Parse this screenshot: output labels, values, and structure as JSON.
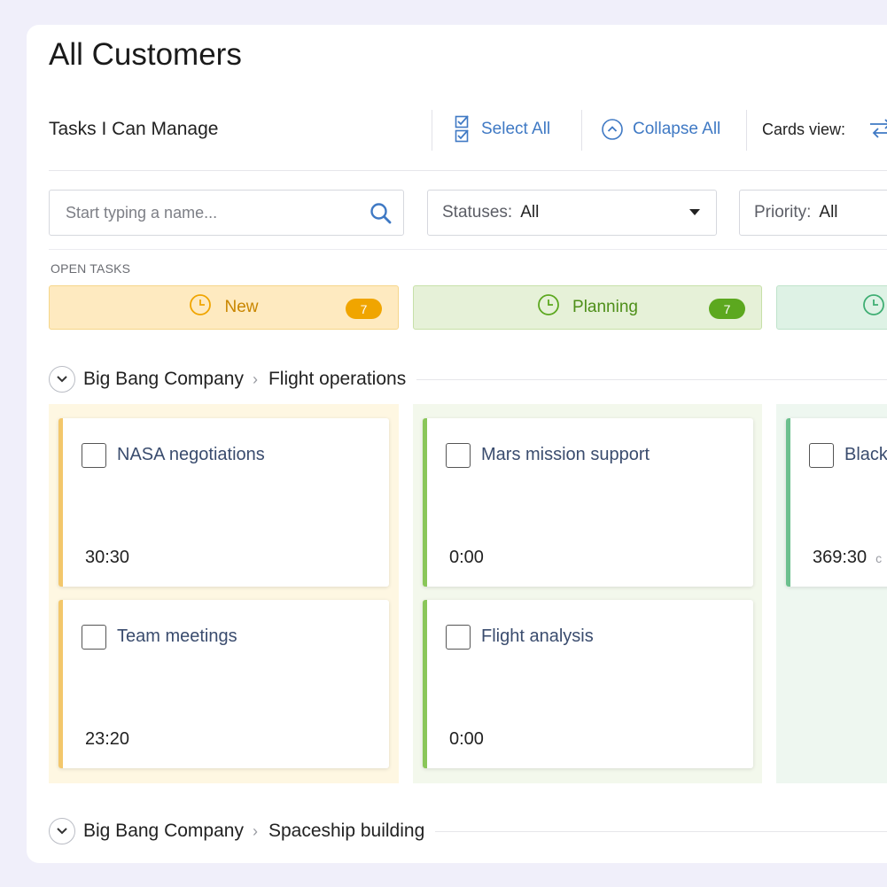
{
  "page": {
    "title": "All Customers"
  },
  "toolbar": {
    "section_label": "Tasks I Can Manage",
    "select_all": "Select All",
    "collapse_all": "Collapse All",
    "cards_view_label": "Cards view:"
  },
  "filters": {
    "search_placeholder": "Start typing a name...",
    "statuses": {
      "label": "Statuses:",
      "value": "All"
    },
    "priority": {
      "label": "Priority:",
      "value": "All"
    }
  },
  "open_tasks_label": "OPEN TASKS",
  "status_columns": [
    {
      "label": "New",
      "count": "7",
      "color": "#f0a500"
    },
    {
      "label": "Planning",
      "count": "7",
      "color": "#5ca81f"
    },
    {
      "label": "",
      "count": "",
      "color": "#3fae73"
    }
  ],
  "groups": [
    {
      "customer": "Big Bang Company",
      "project": "Flight operations",
      "lanes": [
        {
          "cards": [
            {
              "name": "NASA negotiations",
              "time": "30:30"
            },
            {
              "name": "Team meetings",
              "time": "23:20"
            }
          ]
        },
        {
          "cards": [
            {
              "name": "Mars mission support",
              "time": "0:00"
            },
            {
              "name": "Flight analysis",
              "time": "0:00"
            }
          ]
        },
        {
          "cards": [
            {
              "name": "Black",
              "time": "369:30",
              "extra": "c"
            }
          ]
        }
      ]
    },
    {
      "customer": "Big Bang Company",
      "project": "Spaceship building"
    }
  ]
}
